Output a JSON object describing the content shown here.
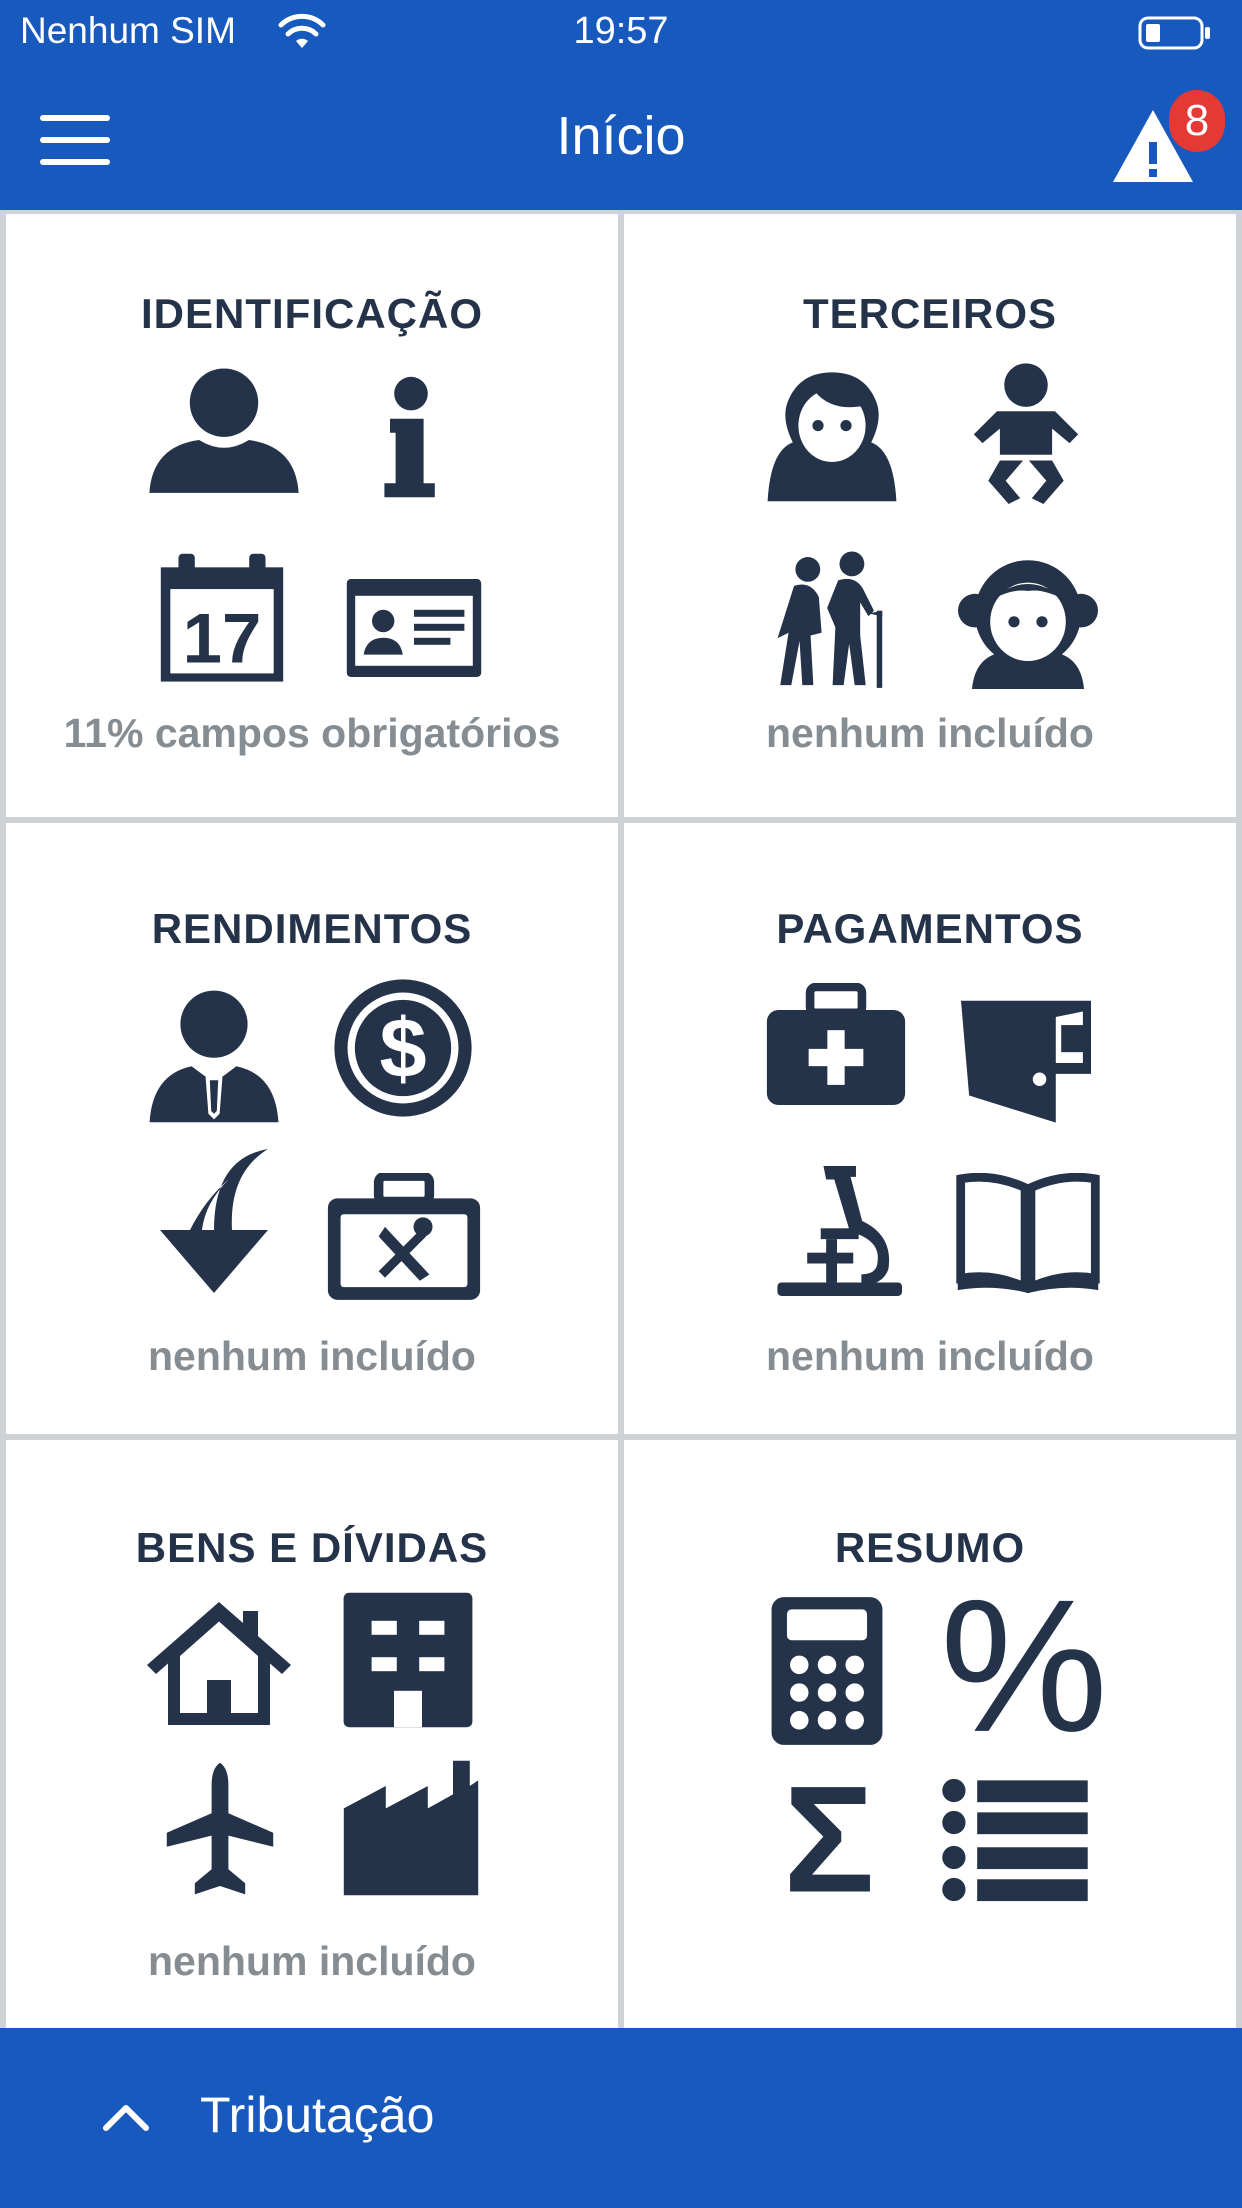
{
  "status_bar": {
    "carrier": "Nenhum SIM",
    "time": "19:57"
  },
  "nav": {
    "title": "Início",
    "alert_count": "8"
  },
  "tiles": [
    {
      "title": "IDENTIFICAÇÃO",
      "status": "11% campos obrigatórios",
      "icons": [
        "person-icon",
        "info-icon",
        "calendar-icon",
        "id-card-icon"
      ],
      "calendar_day": "17"
    },
    {
      "title": "TERCEIROS",
      "status": "nenhum incluído",
      "icons": [
        "woman-icon",
        "baby-icon",
        "elderly-couple-icon",
        "girl-icon"
      ]
    },
    {
      "title": "RENDIMENTOS",
      "status": "nenhum incluído",
      "icons": [
        "employee-icon",
        "dollar-coin-icon",
        "income-arrow-icon",
        "toolbox-icon"
      ]
    },
    {
      "title": "PAGAMENTOS",
      "status": "nenhum incluído",
      "icons": [
        "medical-kit-icon",
        "wallet-icon",
        "microscope-icon",
        "open-book-icon"
      ]
    },
    {
      "title": "BENS E DÍVIDAS",
      "status": "nenhum incluído",
      "icons": [
        "house-icon",
        "building-icon",
        "airplane-icon",
        "factory-icon"
      ]
    },
    {
      "title": "RESUMO",
      "status": "",
      "icons": [
        "calculator-icon",
        "percent-icon",
        "sigma-icon",
        "list-icon"
      ],
      "percent_symbol": "%",
      "sigma_symbol": "Σ"
    }
  ],
  "bottom_bar": {
    "label": "Tributação"
  },
  "colors": {
    "primary": "#1859be",
    "icon": "#243349",
    "status_text": "#858d93",
    "badge": "#e53935",
    "divider": "#cfd2d4"
  }
}
